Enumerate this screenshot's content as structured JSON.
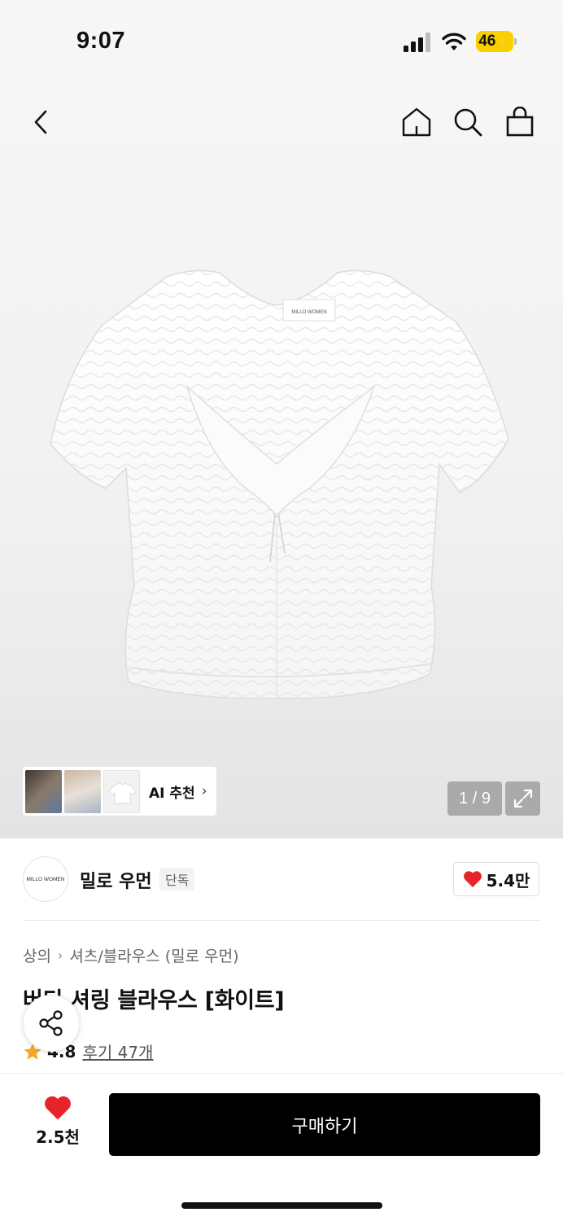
{
  "status_bar": {
    "time": "9:07",
    "battery": "46"
  },
  "gallery": {
    "ai_label": "AI 추천",
    "counter": "1 / 9"
  },
  "brand": {
    "logo_text": "MILLO WOMEN",
    "name": "밀로 우먼",
    "badge": "단독",
    "likes": "5.4만"
  },
  "breadcrumb": {
    "level1": "상의",
    "level2": "셔츠/블라우스 (밀로 우먼)"
  },
  "product": {
    "title": "버디 셔링 블라우스 [화이트]",
    "rating": "4.8",
    "reviews": "후기 47개"
  },
  "bottom": {
    "wish_count": "2.5천",
    "buy_label": "구매하기"
  },
  "colors": {
    "heart": "#e8242b",
    "star": "#f5a623",
    "battery": "#f8d000"
  }
}
